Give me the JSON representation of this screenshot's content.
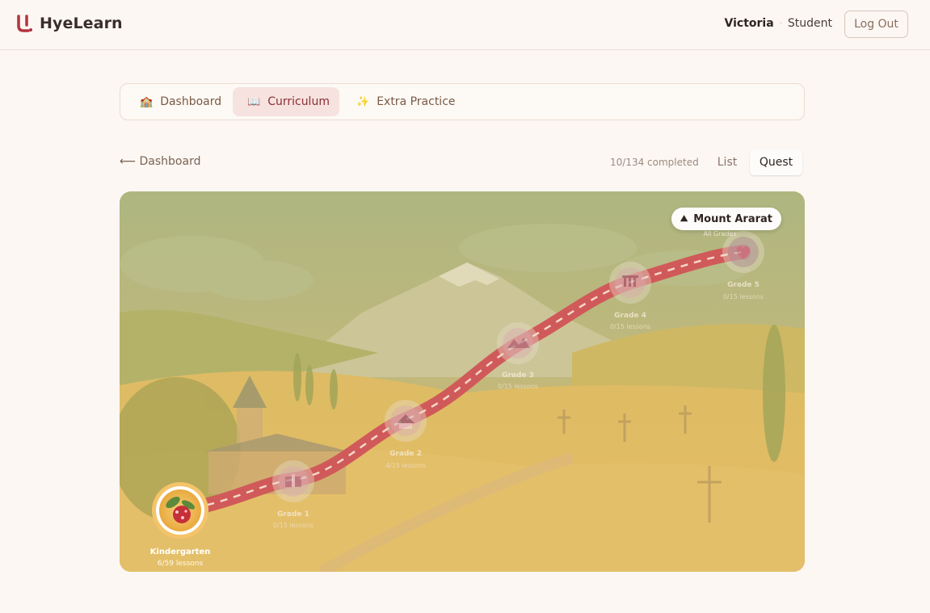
{
  "app": {
    "name": "HyeLearn"
  },
  "user": {
    "name": "Victoria",
    "separator": "·",
    "role": "Student",
    "logout_label": "Log Out"
  },
  "tabs": [
    {
      "icon": "🏫",
      "label": "Dashboard",
      "active": false
    },
    {
      "icon": "📖",
      "label": "Curriculum",
      "active": true
    },
    {
      "icon": "✨",
      "label": "Extra Practice",
      "active": false
    }
  ],
  "toolbar": {
    "back_label": "⟵ Dashboard",
    "progress": "10/134 completed",
    "view_list": "List",
    "view_quest": "Quest",
    "active_view": "Quest"
  },
  "quest": {
    "summit_label": "Mount Ararat",
    "summit_sub": "All Grades",
    "road_color": "#c9404f",
    "nodes": [
      {
        "title": "Kindergarten",
        "sub": "6/59 lessons",
        "icon": "pomegranate-icon",
        "state": "current"
      },
      {
        "title": "Grade 1",
        "sub": "0/15 lessons",
        "icon": "gift-icon",
        "state": "locked"
      },
      {
        "title": "Grade 2",
        "sub": "4/15 lessons",
        "icon": "house-icon",
        "state": "locked"
      },
      {
        "title": "Grade 3",
        "sub": "0/15 lessons",
        "icon": "mountains-icon",
        "state": "locked"
      },
      {
        "title": "Grade 4",
        "sub": "0/15 lessons",
        "icon": "temple-icon",
        "state": "locked"
      },
      {
        "title": "Grade 5",
        "sub": "0/15 lessons",
        "icon": "heart-icon",
        "state": "locked"
      }
    ]
  },
  "colors": {
    "accent": "#8a2f36",
    "background": "#fcf7f3",
    "brand": "#b3343e"
  }
}
